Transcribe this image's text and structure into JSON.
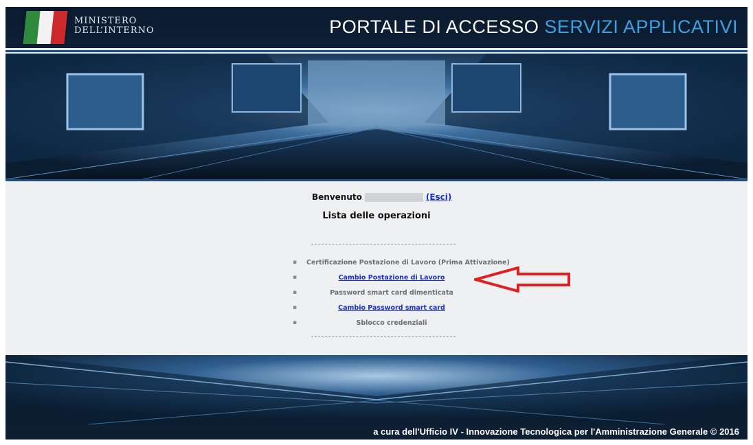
{
  "header": {
    "org_line1": "MINISTERO",
    "org_line2": "DELL’INTERNO",
    "title_white": "PORTALE DI ACCESSO",
    "title_blue": "SERVIZI APPLICATIVI",
    "flag_colors": [
      "#2f8a3e",
      "#f2f2f2",
      "#cc2a2a"
    ]
  },
  "welcome": {
    "label": "Benvenuto",
    "logout_link": "(Esci)"
  },
  "operations": {
    "title": "Lista delle operazioni",
    "items": [
      {
        "label": "Certificazione Postazione di Lavoro (Prima Attivazione)",
        "link": false
      },
      {
        "label": "Cambio Postazione di Lavoro",
        "link": true
      },
      {
        "label": "Password smart card dimenticata",
        "link": false
      },
      {
        "label": "Cambio Password smart card",
        "link": true
      },
      {
        "label": "Sblocco credenziali",
        "link": false
      }
    ]
  },
  "footer": {
    "text": "a cura dell'Ufficio IV - Innovazione Tecnologica per l'Amministrazione Generale  © 2016"
  },
  "colors": {
    "header_bg": "#0e2138",
    "title_accent": "#3fa0e0",
    "link": "#1a2fd0",
    "arrow": "#e02020"
  }
}
